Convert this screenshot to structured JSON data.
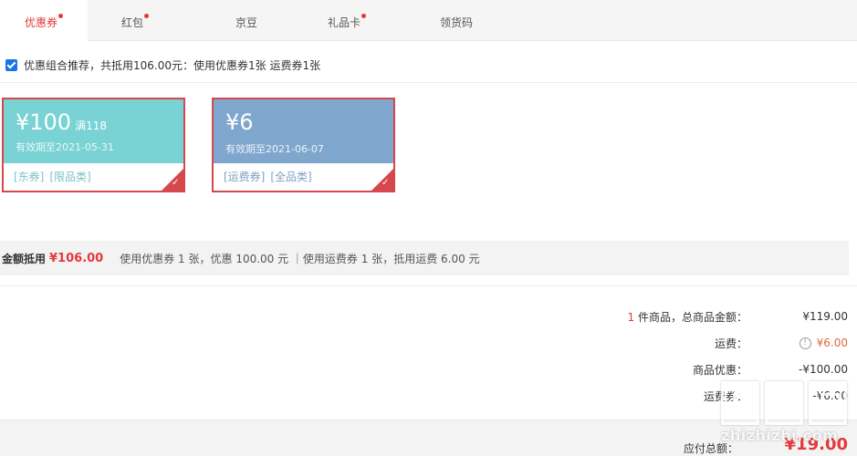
{
  "tabs": [
    {
      "label": "优惠券",
      "dot": true,
      "active": true
    },
    {
      "label": "红包",
      "dot": true,
      "active": false
    },
    {
      "label": "京豆",
      "dot": false,
      "active": false
    },
    {
      "label": "礼品卡",
      "dot": true,
      "active": false
    },
    {
      "label": "领货码",
      "dot": false,
      "active": false
    }
  ],
  "combo": {
    "checked": true,
    "text": "优惠组合推荐，共抵用106.00元：使用优惠券1张 运费券1张"
  },
  "coupons": [
    {
      "amount": "¥100",
      "condition": "满118",
      "valid": "有效期至2021-05-31",
      "tags": [
        "[东券]",
        "[限品类]"
      ],
      "color": "#79d2d4",
      "selected": true
    },
    {
      "amount": "¥6",
      "condition": "",
      "valid": "有效期至2021-06-07",
      "tags": [
        "[运费券]",
        "[全品类]"
      ],
      "color": "#7fa7cd",
      "selected": true
    }
  ],
  "summary": {
    "label": "金额抵用",
    "amount": "¥106.00",
    "desc": "使用优惠券 1 张，优惠 100.00 元 ｜使用运费券 1 张，抵用运费 6.00 元"
  },
  "totals": {
    "items": {
      "count": "1",
      "label": " 件商品，总商品金额：",
      "value": "¥119.00"
    },
    "shipping": {
      "label": "运费：",
      "value": "¥6.00"
    },
    "discount": {
      "label": "商品优惠：",
      "value": "-¥100.00"
    },
    "shipping_coupon": {
      "label": "运费券：",
      "value": "-¥6.00"
    }
  },
  "footer": {
    "label": "应付总额：",
    "value": "¥19.00"
  },
  "watermark": {
    "text": "zhizhizhi.com"
  },
  "colors": {
    "accent": "#e4393c",
    "coupon_teal": "#79d2d4",
    "coupon_blue": "#7fa7cd"
  }
}
